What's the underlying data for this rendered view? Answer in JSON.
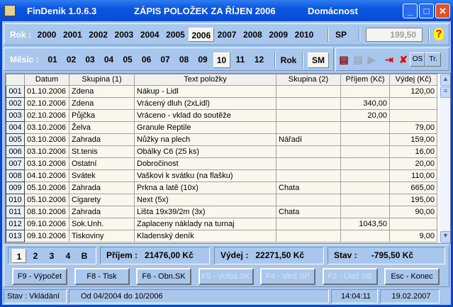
{
  "window": {
    "app": "FinDenik 1.0.6.3",
    "heading": "ZÁPIS POLOŽEK ZA ŘÍJEN 2006",
    "profile": "Domácnost"
  },
  "years": {
    "label": "Rok :",
    "items": [
      "2000",
      "2001",
      "2002",
      "2003",
      "2004",
      "2005",
      "2006",
      "2007",
      "2008",
      "2009",
      "2010"
    ],
    "selected": "2006",
    "sp_label": "SP",
    "sp_value": "199,50"
  },
  "months": {
    "label": "Měsíc :",
    "items": [
      "01",
      "02",
      "03",
      "04",
      "05",
      "06",
      "07",
      "08",
      "09",
      "10",
      "11",
      "12"
    ],
    "selected": "10",
    "rok_label": "Rok",
    "sm_label": "SM",
    "os_label": "OS",
    "tr_label": "Tr."
  },
  "table": {
    "columns": [
      "Datum",
      "Skupina (1)",
      "Text položky",
      "Skupina (2)",
      "Příjem (Kč)",
      "Výdej (Kč)"
    ],
    "rows": [
      [
        "001",
        "01.10.2006",
        "Zdena",
        "Nákup - Lidl",
        "",
        "",
        "120,00"
      ],
      [
        "002",
        "02.10.2006",
        "Zdena",
        "Vrácený dluh (2xLidl)",
        "",
        "340,00",
        ""
      ],
      [
        "003",
        "02.10.2006",
        "Půjčka",
        "Vráceno - vklad do soutěže",
        "",
        "20,00",
        ""
      ],
      [
        "004",
        "03.10.2006",
        "Želva",
        "Granule Reptile",
        "",
        "",
        "79,00"
      ],
      [
        "005",
        "03.10.2006",
        "Zahrada",
        "Nůžky na plech",
        "Nářadí",
        "",
        "159,00"
      ],
      [
        "006",
        "03.10.2006",
        "St.tenis",
        "Obálky C6 (25 ks)",
        "",
        "",
        "16,00"
      ],
      [
        "007",
        "03.10.2006",
        "Ostatní",
        "Dobročinost",
        "",
        "",
        "20,00"
      ],
      [
        "008",
        "04.10.2006",
        "Svátek",
        "Vaškovi k svátku (na flašku)",
        "",
        "",
        "110,00"
      ],
      [
        "009",
        "05.10.2006",
        "Zahrada",
        "Prkna a latě (10x)",
        "Chata",
        "",
        "665,00"
      ],
      [
        "010",
        "05.10.2006",
        "Cigarety",
        "Next (5x)",
        "",
        "",
        "195,00"
      ],
      [
        "011",
        "08.10.2006",
        "Zahrada",
        "Lišta 19x39/2m (3x)",
        "Chata",
        "",
        "90,00"
      ],
      [
        "012",
        "09.10.2006",
        "Sok.Unh.",
        "Zaplaceny náklady na turnaj",
        "",
        "1043,50",
        ""
      ],
      [
        "013",
        "09.10.2006",
        "Tiskoviny",
        "Kladenský deník",
        "",
        "",
        "9,00"
      ]
    ]
  },
  "pages": {
    "items": [
      "1",
      "2",
      "3",
      "4",
      "B"
    ],
    "selected": "1"
  },
  "totals": {
    "income_label": "Příjem :",
    "income": "21476,00 Kč",
    "expense_label": "Výdej :",
    "expense": "22271,50 Kč",
    "balance_label": "Stav :",
    "balance": "-795,50 Kč"
  },
  "buttons": [
    {
      "label": "F9 - Výpočet",
      "enabled": true
    },
    {
      "label": "F8 - Tisk",
      "enabled": true
    },
    {
      "label": "F6 - Obn.SK",
      "enabled": true
    },
    {
      "label": "F5 - Volba SK",
      "enabled": false
    },
    {
      "label": "F4 - Vlož SP",
      "enabled": false
    },
    {
      "label": "F2 - Ulož SB",
      "enabled": false
    },
    {
      "label": "Esc - Konec",
      "enabled": true
    }
  ],
  "status": {
    "mode": "Stav : Vkládání",
    "range": "Od  04/2004  do  10/2006",
    "time": "14:04:11",
    "date": "19.02.2007"
  }
}
